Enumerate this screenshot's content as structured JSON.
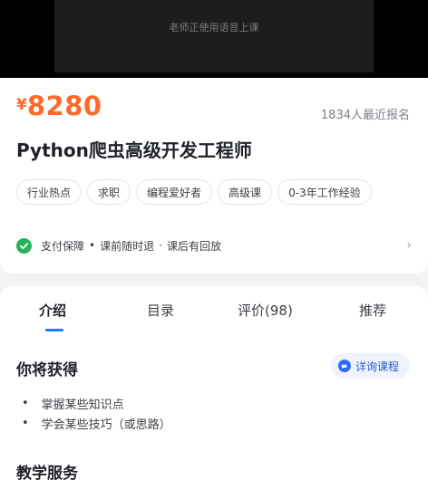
{
  "video": {
    "caption": "老师正使用语音上课"
  },
  "course": {
    "currency": "¥",
    "price": "8280",
    "enroll": "1834人最近报名",
    "title": "Python爬虫高级开发工程师",
    "tags": [
      "行业热点",
      "求职",
      "编程爱好者",
      "高级课",
      "0-3年工作经验"
    ]
  },
  "guarantee": {
    "label": "支付保障",
    "items": [
      "课前随时退",
      "课后有回放"
    ],
    "separator": "·"
  },
  "tabs": [
    {
      "label": "介绍",
      "active": true
    },
    {
      "label": "目录",
      "active": false
    },
    {
      "label": "评价(98)",
      "active": false
    },
    {
      "label": "推荐",
      "active": false
    }
  ],
  "gain": {
    "title": "你将获得",
    "consult_label": "详询课程",
    "bullets": [
      "掌握某些知识点",
      "学会某些技巧（或思路）"
    ]
  },
  "service": {
    "title": "教学服务"
  },
  "colors": {
    "price": "#ff6a2b",
    "accent": "#1f7cff",
    "check": "#27b25a"
  }
}
